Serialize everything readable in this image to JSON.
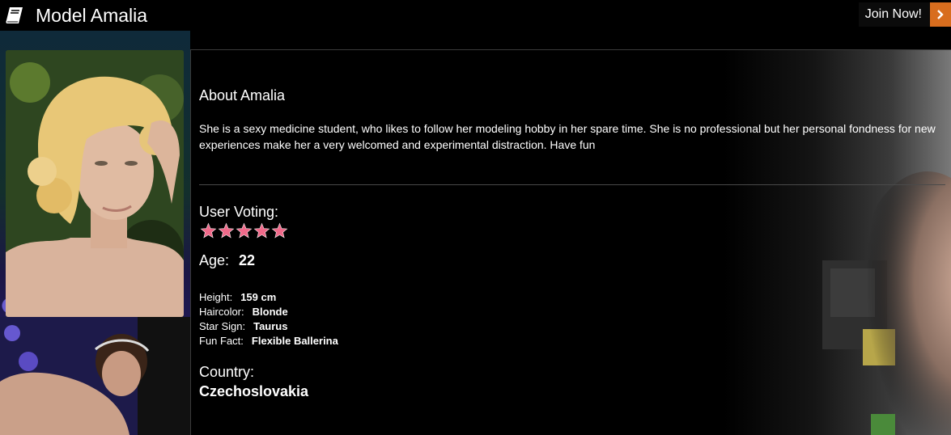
{
  "header": {
    "title": "Model Amalia",
    "join_label": "Join Now!"
  },
  "about": {
    "heading": "About Amalia",
    "text": "She is a sexy medicine student, who likes to follow her modeling hobby in her spare time. She is no professional but her personal fondness for new experiences make her a very welcomed and experimental distraction. Have fun"
  },
  "voting": {
    "label": "User Voting:",
    "rating": 5,
    "max": 5
  },
  "age": {
    "label": "Age:",
    "value": "22"
  },
  "details": [
    {
      "label": "Height:",
      "value": "159 cm"
    },
    {
      "label": "Haircolor:",
      "value": "Blonde"
    },
    {
      "label": "Star Sign:",
      "value": "Taurus"
    },
    {
      "label": "Fun Fact:",
      "value": "Flexible Ballerina"
    }
  ],
  "country": {
    "label": "Country:",
    "value": "Czechoslovakia"
  },
  "colors": {
    "accent": "#d86d1e",
    "star": "#f06a8a",
    "background": "#000000"
  },
  "icons": {
    "title_icon": "book-icon",
    "join_icon": "chevron-right-icon",
    "rating_icon": "star-icon"
  }
}
